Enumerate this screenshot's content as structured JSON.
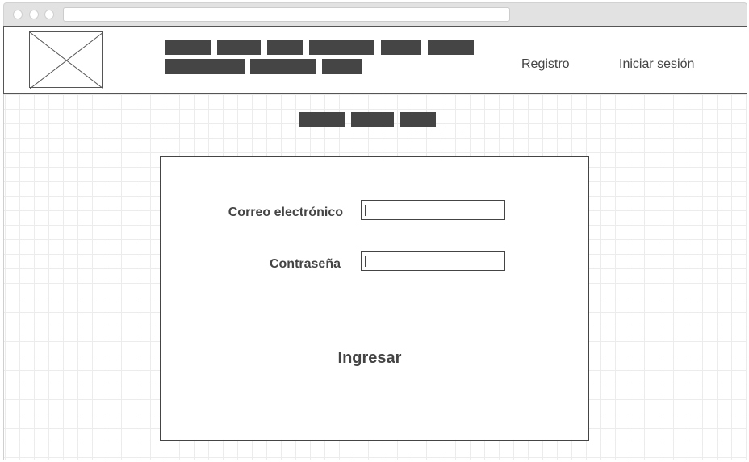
{
  "header": {
    "register_label": "Registro",
    "login_label": "Iniciar sesión"
  },
  "form": {
    "email_label": "Correo electrónico",
    "email_value": "",
    "password_label": "Contraseña",
    "password_value": "",
    "submit_label": "Ingresar"
  },
  "colors": {
    "placeholder_block": "#454545",
    "border": "#444444",
    "grid": "#ececec"
  },
  "icons": {
    "logo": "image-placeholder-icon"
  }
}
